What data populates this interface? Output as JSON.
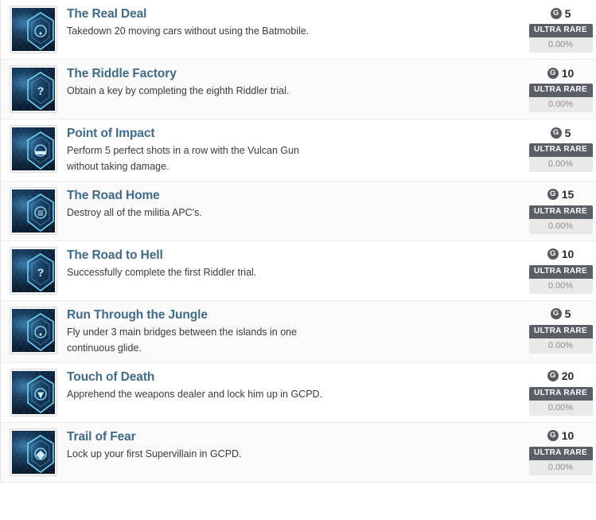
{
  "list": {
    "icon_points": "G",
    "rows": [
      {
        "thumb_glyph": "target-icon",
        "title": "The Real Deal",
        "description": "Takedown 20 moving cars without using the Batmobile.",
        "points": "5",
        "rarity": "ULTRA RARE",
        "percent": "0.00%"
      },
      {
        "thumb_glyph": "question-mark-icon",
        "title": "The Riddle Factory",
        "description": "Obtain a key by completing the eighth Riddler trial.",
        "points": "10",
        "rarity": "ULTRA RARE",
        "percent": "0.00%"
      },
      {
        "thumb_glyph": "vehicle-icon",
        "title": "Point of Impact",
        "description": "Perform 5 perfect shots in a row with the Vulcan Gun without taking damage.",
        "points": "5",
        "rarity": "ULTRA RARE",
        "percent": "0.00%"
      },
      {
        "thumb_glyph": "road-icon",
        "title": "The Road Home",
        "description": "Destroy all of the militia APC's.",
        "points": "15",
        "rarity": "ULTRA RARE",
        "percent": "0.00%"
      },
      {
        "thumb_glyph": "question-mark-icon",
        "title": "The Road to Hell",
        "description": "Successfully complete the first Riddler trial.",
        "points": "10",
        "rarity": "ULTRA RARE",
        "percent": "0.00%"
      },
      {
        "thumb_glyph": "target-icon",
        "title": "Run Through the Jungle",
        "description": "Fly under 3 main bridges between the islands in one continuous glide.",
        "points": "5",
        "rarity": "ULTRA RARE",
        "percent": "0.00%"
      },
      {
        "thumb_glyph": "flame-icon",
        "title": "Touch of Death",
        "description": "Apprehend the weapons dealer and lock him up in GCPD.",
        "points": "20",
        "rarity": "ULTRA RARE",
        "percent": "0.00%"
      },
      {
        "thumb_glyph": "bat-icon",
        "title": "Trail of Fear",
        "description": "Lock up your first Supervillain in GCPD.",
        "points": "10",
        "rarity": "ULTRA RARE",
        "percent": "0.00%"
      }
    ]
  },
  "colors": {
    "title": "#3f6a8a",
    "rarity_bg": "#5b6066",
    "points_badge": "#575b60",
    "row_alt_bg": "#fafafa"
  }
}
